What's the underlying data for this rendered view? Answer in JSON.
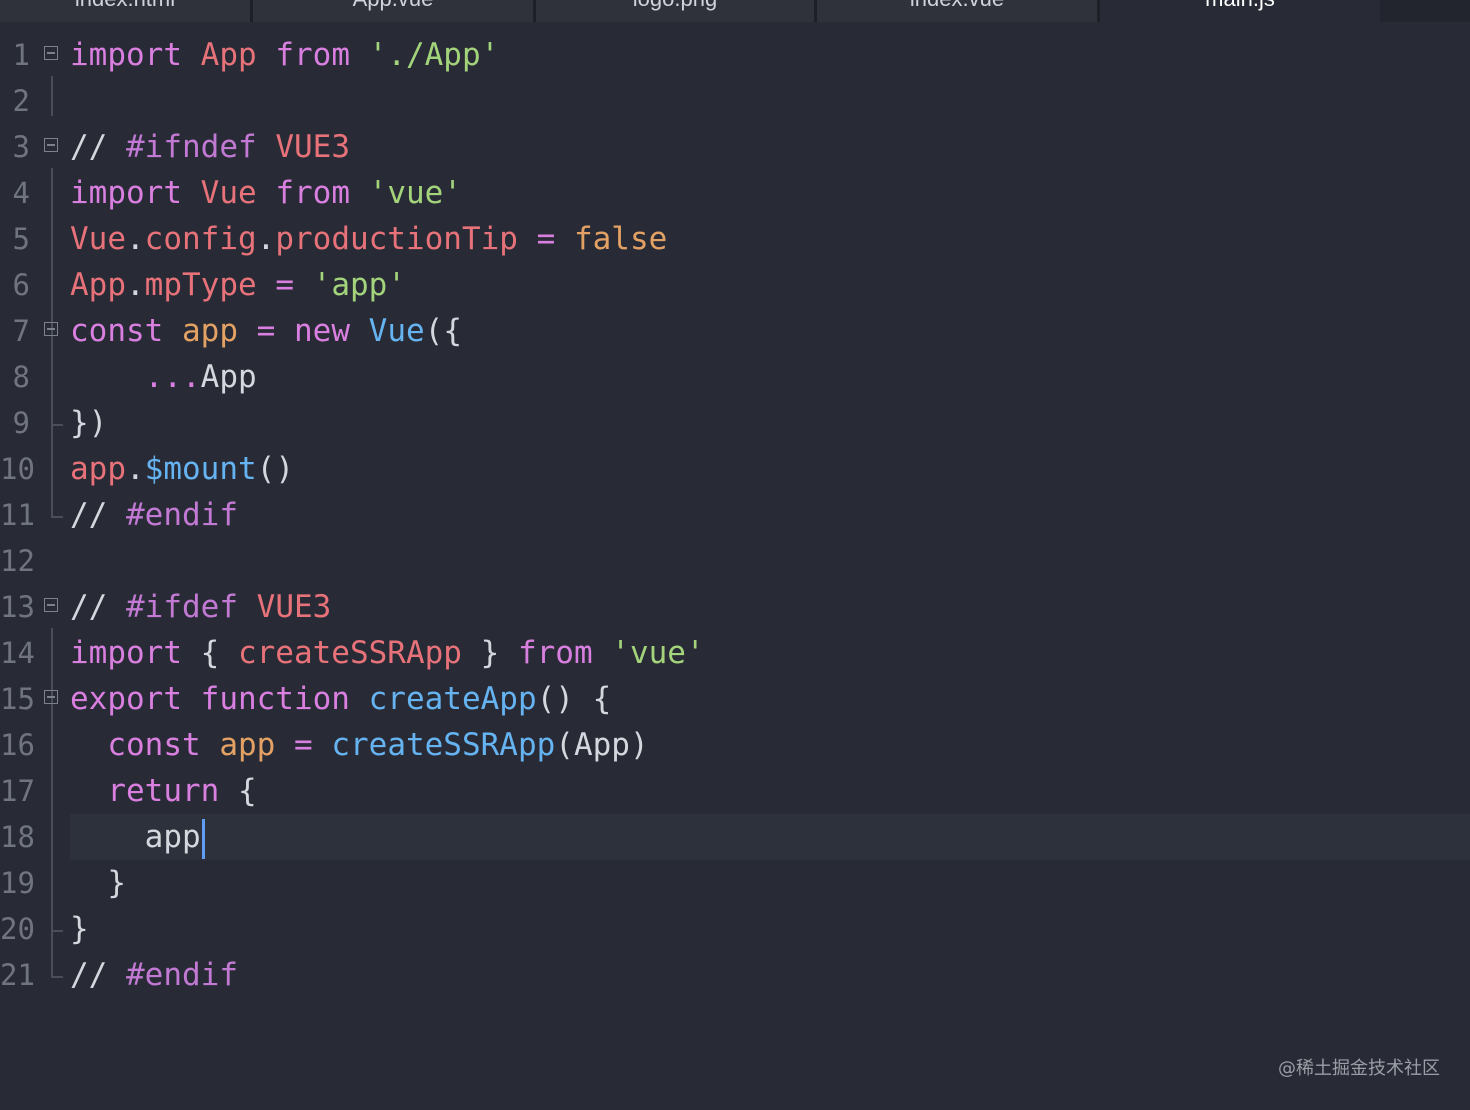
{
  "tabs": [
    {
      "label": "index.html"
    },
    {
      "label": "App.vue"
    },
    {
      "label": "logo.png"
    },
    {
      "label": "index.vue"
    },
    {
      "label": "main.js"
    }
  ],
  "lines": [
    {
      "n": "1"
    },
    {
      "n": "2"
    },
    {
      "n": "3"
    },
    {
      "n": "4"
    },
    {
      "n": "5"
    },
    {
      "n": "6"
    },
    {
      "n": "7"
    },
    {
      "n": "8"
    },
    {
      "n": "9"
    },
    {
      "n": "10"
    },
    {
      "n": "11"
    },
    {
      "n": "12"
    },
    {
      "n": "13"
    },
    {
      "n": "14"
    },
    {
      "n": "15"
    },
    {
      "n": "16"
    },
    {
      "n": "17"
    },
    {
      "n": "18"
    },
    {
      "n": "19"
    },
    {
      "n": "20"
    },
    {
      "n": "21"
    }
  ],
  "code": {
    "l1": [
      "import",
      " ",
      "App",
      " ",
      "from",
      " ",
      "'./App'"
    ],
    "l3": [
      "// ",
      "#ifndef",
      " ",
      "VUE3"
    ],
    "l4": [
      "import",
      " ",
      "Vue",
      " ",
      "from",
      " ",
      "'vue'"
    ],
    "l5": [
      "Vue",
      ".",
      "config",
      ".",
      "productionTip",
      " = ",
      "false"
    ],
    "l6": [
      "App",
      ".",
      "mpType",
      " = ",
      "'app'"
    ],
    "l7": [
      "const",
      " ",
      "app",
      " = ",
      "new",
      " ",
      "Vue",
      "({"
    ],
    "l8": [
      "    ",
      "...",
      "App"
    ],
    "l9": [
      "})"
    ],
    "l10": [
      "app",
      ".",
      "$mount",
      "()"
    ],
    "l11": [
      "// ",
      "#endif"
    ],
    "l13": [
      "// ",
      "#ifdef",
      " ",
      "VUE3"
    ],
    "l14": [
      "import",
      " { ",
      "createSSRApp",
      " } ",
      "from",
      " ",
      "'vue'"
    ],
    "l15": [
      "export",
      " ",
      "function",
      " ",
      "createApp",
      "() {"
    ],
    "l16": [
      "  ",
      "const",
      " ",
      "app",
      " = ",
      "createSSRApp",
      "(App)"
    ],
    "l17": [
      "  ",
      "return",
      " {"
    ],
    "l18": [
      "    ",
      "app"
    ],
    "l19": [
      "  ",
      "}"
    ],
    "l20": [
      "}"
    ],
    "l21": [
      "// ",
      "#endif"
    ]
  },
  "watermark": "@稀土掘金技术社区",
  "colors": {
    "background": "#282b35",
    "keyword": "#d97fe0",
    "identifier": "#e8727a",
    "string": "#a3d37b",
    "function": "#66b3f2",
    "cursor": "#5f9df7"
  }
}
